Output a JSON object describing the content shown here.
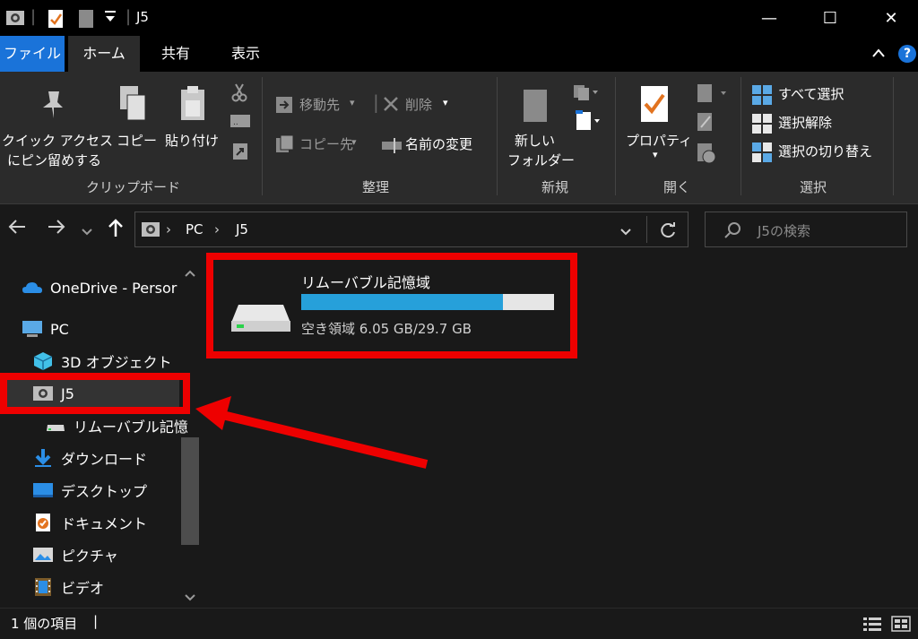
{
  "window": {
    "title": "J5",
    "controls": {
      "minimize": "—",
      "maximize": "☐",
      "close": "✕"
    }
  },
  "tabs": {
    "file": "ファイル",
    "home": "ホーム",
    "share": "共有",
    "view": "表示",
    "help": "?"
  },
  "ribbon": {
    "clipboard": {
      "pin_line1": "クイック アクセス",
      "pin_line2": "にピン留めする",
      "copy": "コピー",
      "paste": "貼り付け",
      "group": "クリップボード"
    },
    "organize": {
      "move_to": "移動先",
      "copy_to": "コピー先",
      "delete": "削除",
      "rename": "名前の変更",
      "group": "整理"
    },
    "new": {
      "folder_line1": "新しい",
      "folder_line2": "フォルダー",
      "group": "新規"
    },
    "open": {
      "properties": "プロパティ",
      "group": "開く"
    },
    "select": {
      "select_all": "すべて選択",
      "select_none": "選択解除",
      "invert": "選択の切り替え",
      "group": "選択"
    }
  },
  "address": {
    "crumbs": [
      "PC",
      "J5"
    ],
    "search_placeholder": "J5の検索"
  },
  "nav": {
    "items": [
      {
        "label": "OneDrive - Persor",
        "icon": "cloud-icon"
      },
      {
        "label": "PC",
        "icon": "computer-icon"
      },
      {
        "label": "3D オブジェクト",
        "icon": "cube-icon"
      },
      {
        "label": "J5",
        "icon": "camera-device-icon"
      },
      {
        "label": "リムーバブル記憶",
        "icon": "drive-icon"
      },
      {
        "label": "ダウンロード",
        "icon": "download-icon"
      },
      {
        "label": "デスクトップ",
        "icon": "desktop-icon"
      },
      {
        "label": "ドキュメント",
        "icon": "document-icon"
      },
      {
        "label": "ピクチャ",
        "icon": "pictures-icon"
      },
      {
        "label": "ビデオ",
        "icon": "video-icon"
      }
    ]
  },
  "content": {
    "drive": {
      "name": "リムーバブル記憶域",
      "free_text": "空き領域 6.05 GB/29.7 GB",
      "used_fraction": 0.7963,
      "bar_color": "#26a0da"
    }
  },
  "status": {
    "count": "1 個の項目"
  },
  "annotation": {
    "color": "#ee0000"
  }
}
